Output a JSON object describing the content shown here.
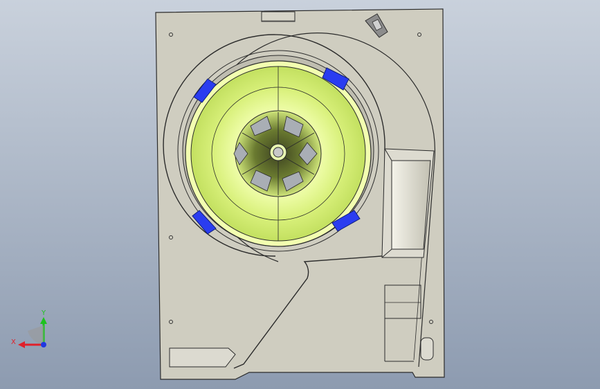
{
  "viewport": {
    "background_top": "#c9d1dc",
    "background_bottom": "#8d9bb0",
    "part_fill": "#cfcdc0",
    "part_edge": "#2b2b2b",
    "impeller_fill": "#d8f07a",
    "impeller_highlight": "#f2ffb0",
    "clip_fill": "#2a3cf0",
    "hub_fill": "#b9b9b9"
  },
  "triad": {
    "x_label": "X",
    "y_label": "Y",
    "x_color": "#e0202a",
    "y_color": "#1ec21e",
    "z_color": "#2038e0"
  }
}
